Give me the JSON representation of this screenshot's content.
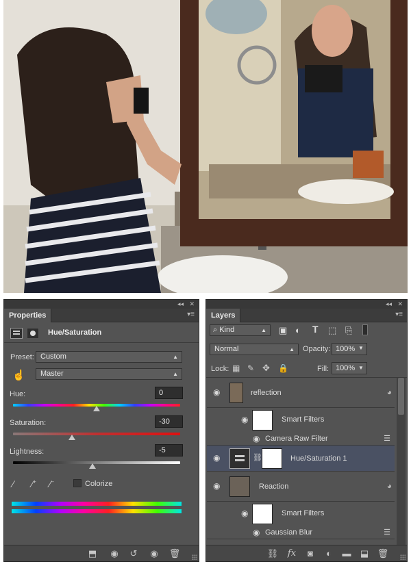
{
  "properties_panel": {
    "tab_label": "Properties",
    "adjustment_title": "Hue/Saturation",
    "preset_label": "Preset:",
    "preset_value": "Custom",
    "channel_value": "Master",
    "hue_label": "Hue:",
    "hue_value": "0",
    "saturation_label": "Saturation:",
    "saturation_value": "-30",
    "lightness_label": "Lightness:",
    "lightness_value": "-5",
    "colorize_label": "Colorize"
  },
  "layers_panel": {
    "tab_label": "Layers",
    "kind_value": "Kind",
    "blend_mode": "Normal",
    "opacity_label": "Opacity:",
    "opacity_value": "100%",
    "lock_label": "Lock:",
    "fill_label": "Fill:",
    "fill_value": "100%",
    "layers": [
      {
        "name": "reflection"
      },
      {
        "name": "Smart Filters"
      },
      {
        "name": "Camera Raw Filter"
      },
      {
        "name": "Hue/Saturation 1"
      },
      {
        "name": "Reaction"
      },
      {
        "name": "Smart Filters"
      },
      {
        "name": "Gaussian Blur"
      }
    ]
  },
  "colors": {
    "panel_bg": "#535353",
    "selected_layer": "#4a5163",
    "tab_bar": "#3c3c3c"
  }
}
